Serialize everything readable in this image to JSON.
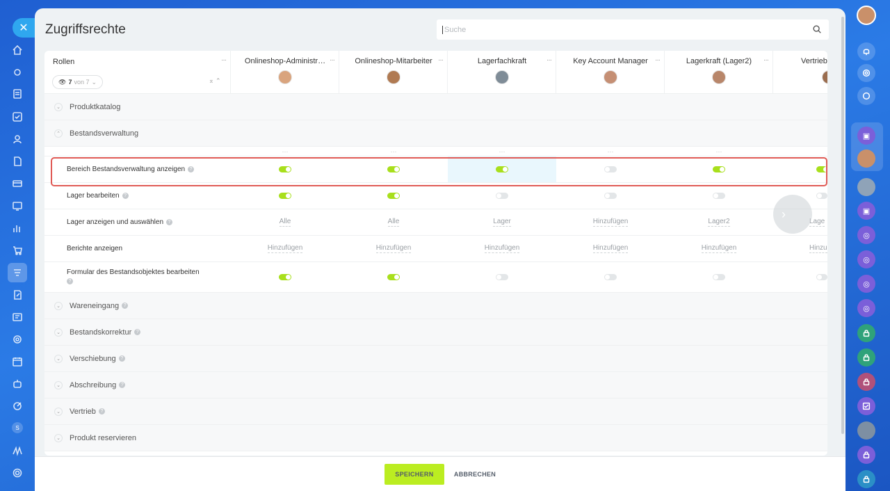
{
  "panel": {
    "title": "Zugriffsrechte"
  },
  "search": {
    "placeholder": "Suche"
  },
  "roles": {
    "label": "Rollen",
    "filter_count": "7",
    "filter_of": "von 7"
  },
  "columns": [
    {
      "name": "Onlineshop-Administr…",
      "avatar": "photo"
    },
    {
      "name": "Onlineshop-Mitarbeiter",
      "avatar": "photo"
    },
    {
      "name": "Lagerfachkraft",
      "avatar": "generic"
    },
    {
      "name": "Key Account Manager",
      "avatar": "photo"
    },
    {
      "name": "Lagerkraft (Lager2)",
      "avatar": "photo"
    },
    {
      "name": "Vertrieb",
      "avatar": "photo"
    }
  ],
  "sections": {
    "produktkatalog": "Produktkatalog",
    "bestandsverwaltung": "Bestandsverwaltung",
    "wareneingang": "Wareneingang",
    "bestandskorrektur": "Bestandskorrektur",
    "verschiebung": "Verschiebung",
    "abschreibung": "Abschreibung",
    "vertrieb": "Vertrieb",
    "produkt_reservieren": "Produkt reservieren"
  },
  "permissions": [
    {
      "label": "Bereich Bestandsverwaltung anzeigen",
      "type": "toggle",
      "values": [
        true,
        true,
        true,
        false,
        true,
        true
      ]
    },
    {
      "label": "Lager bearbeiten",
      "type": "toggle",
      "values": [
        true,
        true,
        false,
        false,
        false,
        false
      ]
    },
    {
      "label": "Lager anzeigen und auswählen",
      "type": "text",
      "values": [
        "Alle",
        "Alle",
        "Lager",
        "Hinzufügen",
        "Lager2",
        "Lage"
      ]
    },
    {
      "label": "Berichte anzeigen",
      "type": "text",
      "values": [
        "Hinzufügen",
        "Hinzufügen",
        "Hinzufügen",
        "Hinzufügen",
        "Hinzufügen",
        "Hinzu"
      ]
    },
    {
      "label": "Formular des Bestandsobjektes bearbeiten",
      "type": "toggle",
      "values": [
        true,
        true,
        false,
        false,
        false,
        false
      ]
    }
  ],
  "footer": {
    "save": "SPEICHERN",
    "cancel": "ABBRECHEN"
  },
  "left_rail_badge": "S",
  "colors": {
    "toggle_on": "#a8df1c",
    "save_button": "#bbed21",
    "highlight": "#e05a55"
  }
}
